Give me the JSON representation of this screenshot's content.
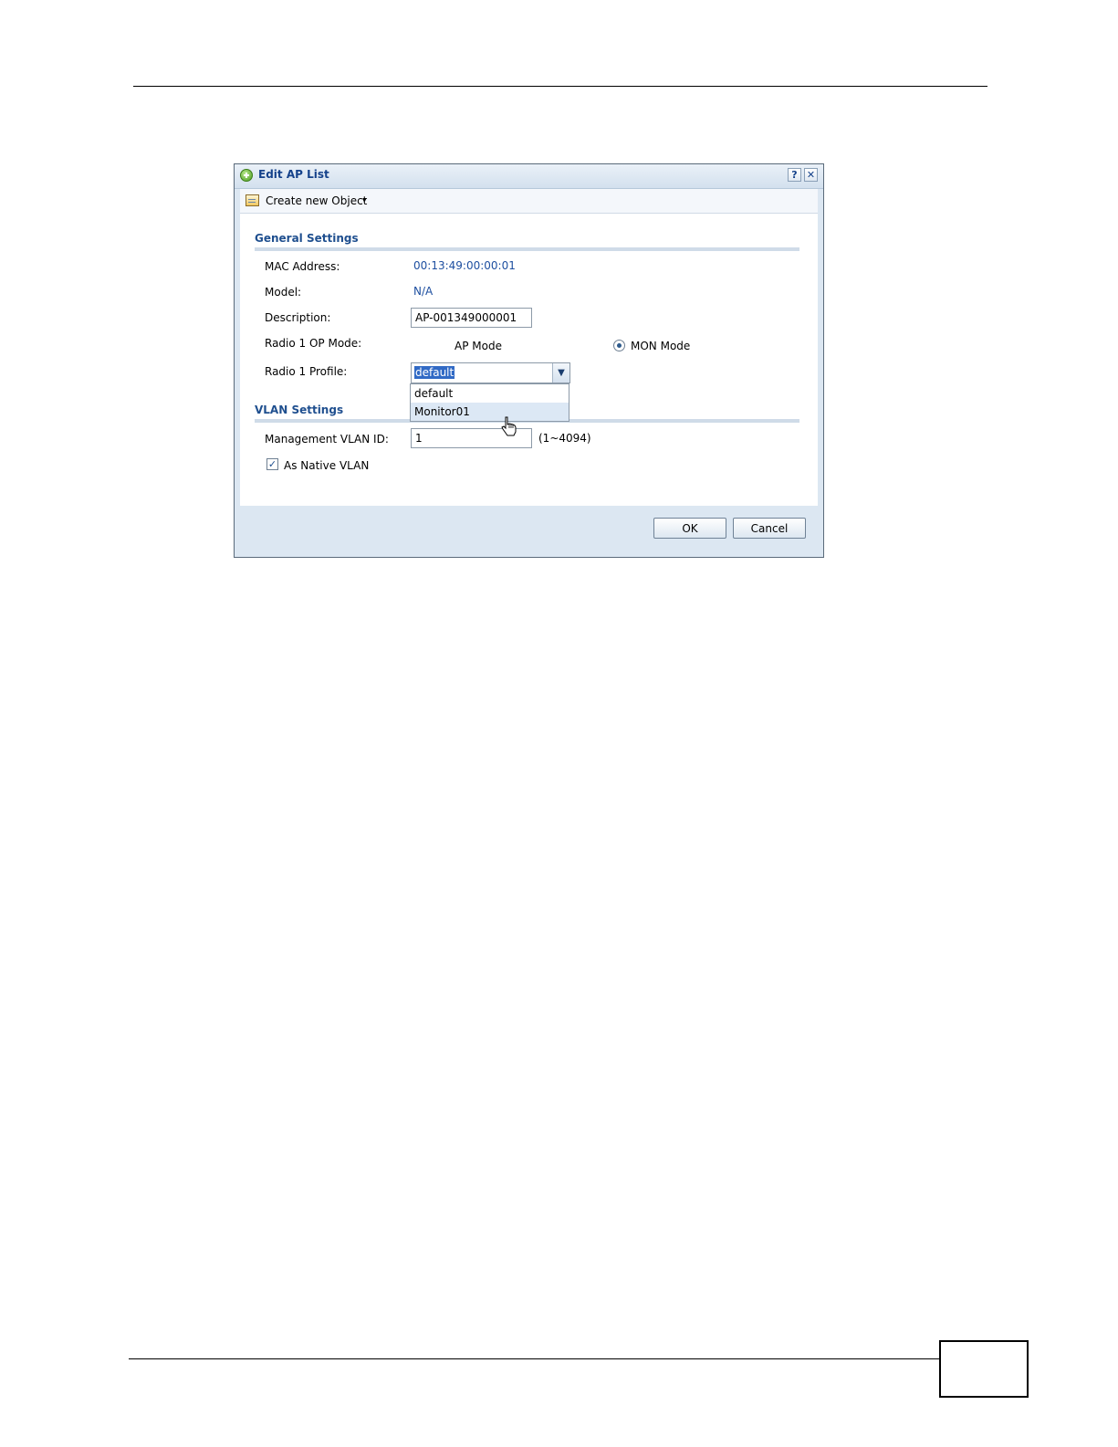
{
  "dialog": {
    "title": "Edit AP List",
    "help_symbol": "?",
    "close_symbol": "✕"
  },
  "toolbar": {
    "create_label": "Create new Object",
    "caret_symbol": "▾"
  },
  "general": {
    "section_title": "General Settings",
    "mac_label": "MAC Address:",
    "mac_value": "00:13:49:00:00:01",
    "model_label": "Model:",
    "model_value": "N/A",
    "description_label": "Description:",
    "description_value": "AP-001349000001",
    "op_mode_label": "Radio 1 OP Mode:",
    "op_mode_options": [
      "AP Mode",
      "MON Mode"
    ],
    "op_mode_selected": "MON Mode",
    "profile_label": "Radio 1 Profile:",
    "profile_value": "default",
    "profile_options": [
      "default",
      "Monitor01"
    ],
    "profile_hovered": "Monitor01"
  },
  "vlan": {
    "section_title": "VLAN Settings",
    "mgmt_label": "Management VLAN ID:",
    "mgmt_value": "1",
    "mgmt_range": "(1~4094)",
    "native_label": "As Native VLAN",
    "native_checked": true
  },
  "buttons": {
    "ok": "OK",
    "cancel": "Cancel"
  },
  "colors": {
    "title_text": "#15428b",
    "section_title": "#1f4f8f",
    "value_text": "#1e4fa0",
    "selection_highlight": "#316ac5"
  },
  "icons": {
    "title": "add-circle-icon",
    "toolbar": "object-list-icon",
    "cursor": "hand-pointer-icon"
  }
}
